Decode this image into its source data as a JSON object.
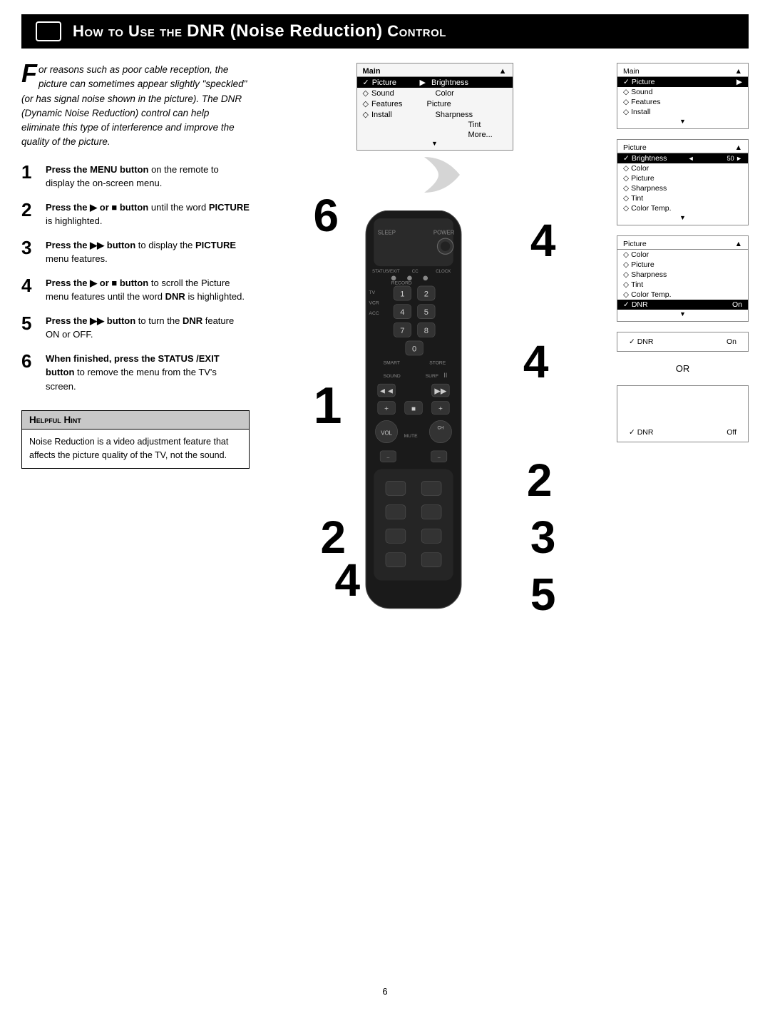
{
  "header": {
    "title_prefix": "How to Use the ",
    "title_bold": "DNR (Noise Reduction)",
    "title_suffix": " Control"
  },
  "intro": {
    "drop_cap": "F",
    "text": "or reasons such as poor cable reception, the picture can sometimes appear slightly \"speckled\" (or has signal noise shown in the picture). The DNR (Dynamic Noise Reduction) control can help eliminate this type of interference and improve the quality of the picture."
  },
  "steps": [
    {
      "num": "1",
      "text": "Press the MENU button on the remote to display the on-screen menu."
    },
    {
      "num": "2",
      "text": "Press the ▶ or ■ button until the word PICTURE is highlighted."
    },
    {
      "num": "3",
      "text": "Press the ▶▶ button to display the PICTURE menu features."
    },
    {
      "num": "4",
      "text": "Press the ▶ or ■ button to scroll the Picture menu features until the word DNR is highlighted."
    },
    {
      "num": "5",
      "text": "Press the ▶▶ button to turn the DNR feature ON or OFF."
    },
    {
      "num": "6",
      "text": "When finished, press the STATUS/EXIT button to remove the menu from the TV's screen."
    }
  ],
  "hint": {
    "title": "Helpful Hint",
    "body": "Noise Reduction is a video adjustment feature that affects the picture quality of the TV, not the sound."
  },
  "menu1": {
    "header_left": "Main",
    "header_arrow": "▲",
    "rows": [
      {
        "check": "✓",
        "label": "Picture",
        "arrow": "▶",
        "right": "Brightness",
        "selected": true
      },
      {
        "diamond": "◇",
        "label": "Sound",
        "right": "Color"
      },
      {
        "diamond": "◇",
        "label": "Features",
        "right": "Picture"
      },
      {
        "diamond": "◇",
        "label": "Install",
        "right": "Sharpness"
      },
      {
        "diamond": "",
        "label": "",
        "right": "Tint"
      },
      {
        "diamond": "",
        "label": "",
        "right": "More..."
      }
    ],
    "arrow_down": "▼"
  },
  "menu2": {
    "header_left": "Picture",
    "header_arrow": "▲",
    "rows": [
      {
        "check": "✓",
        "label": "Brightness",
        "right": "◄ ━━━━━━━━ 50 ►",
        "selected": true
      },
      {
        "diamond": "◇",
        "label": "Color",
        "right": ""
      },
      {
        "diamond": "◇",
        "label": "Picture",
        "right": ""
      },
      {
        "diamond": "◇",
        "label": "Sharpness",
        "right": ""
      },
      {
        "diamond": "◇",
        "label": "Tint",
        "right": ""
      },
      {
        "diamond": "◇",
        "label": "Color Temp.",
        "right": ""
      }
    ],
    "arrow_down": "▼"
  },
  "menu3": {
    "header_left": "Picture",
    "header_arrow": "▲",
    "rows": [
      {
        "diamond": "◇",
        "label": "Color",
        "right": ""
      },
      {
        "diamond": "◇",
        "label": "Picture",
        "right": ""
      },
      {
        "diamond": "◇",
        "label": "Sharpness",
        "right": ""
      },
      {
        "diamond": "◇",
        "label": "Tint",
        "right": ""
      },
      {
        "diamond": "◇",
        "label": "Color Temp.",
        "right": ""
      },
      {
        "check": "✓",
        "label": "DNR",
        "right": "On",
        "selected": true
      }
    ],
    "arrow_down": "▼"
  },
  "menu4_dnr_on": {
    "label": "✓ DNR",
    "value": "On"
  },
  "menu5_dnr_off": {
    "label": "✓ DNR",
    "value": "Off"
  },
  "or_label": "OR",
  "page_number": "6",
  "remote": {
    "big_numbers": [
      "6",
      "4",
      "1",
      "4",
      "2",
      "2",
      "4",
      "3",
      "5"
    ]
  }
}
